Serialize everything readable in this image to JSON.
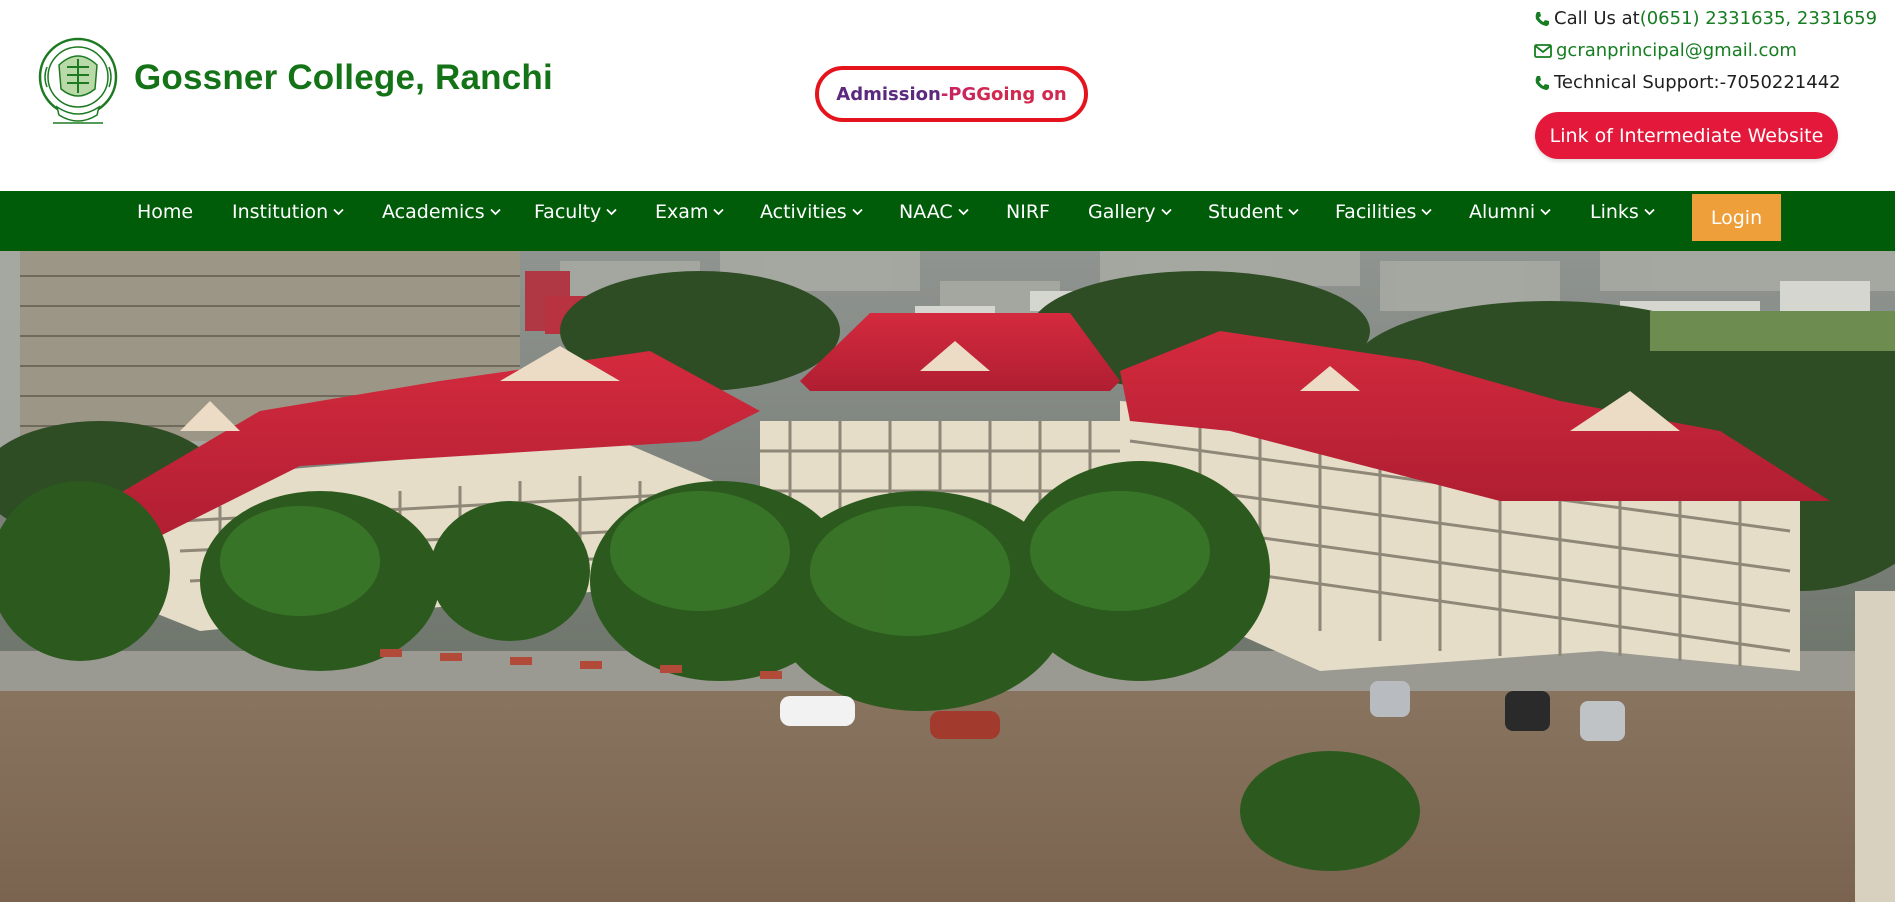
{
  "header": {
    "college_name": "Gossner College, Ranchi",
    "logo_icon": "college-seal-logo",
    "admission": {
      "part1": "Admission",
      "part2": "-PG ",
      "part3": "Going on"
    },
    "contact": {
      "phone_label": "Call Us at ",
      "phone_numbers": "(0651) 2331635, 2331659",
      "email": "gcranprincipal@gmail.com",
      "tech_support": "Technical Support:-7050221442"
    },
    "intermediate_button": "Link of Intermediate Website"
  },
  "nav": {
    "items": [
      {
        "label": "Home",
        "dropdown": false
      },
      {
        "label": "Institution",
        "dropdown": true
      },
      {
        "label": "Academics",
        "dropdown": true
      },
      {
        "label": "Faculty",
        "dropdown": true
      },
      {
        "label": "Exam",
        "dropdown": true
      },
      {
        "label": "Activities",
        "dropdown": true
      },
      {
        "label": "NAAC",
        "dropdown": true
      },
      {
        "label": "NIRF",
        "dropdown": false
      },
      {
        "label": "Gallery",
        "dropdown": true
      },
      {
        "label": "Student",
        "dropdown": true
      },
      {
        "label": "Facilities",
        "dropdown": true
      },
      {
        "label": "Alumni",
        "dropdown": true
      },
      {
        "label": "Links",
        "dropdown": true
      }
    ],
    "login": "Login"
  },
  "hero": {
    "image_icon": "campus-aerial-photo"
  },
  "colors": {
    "brand_green": "#137316",
    "nav_green": "#005c09",
    "accent_red": "#e3183a",
    "login_orange": "#ee9f3a"
  }
}
